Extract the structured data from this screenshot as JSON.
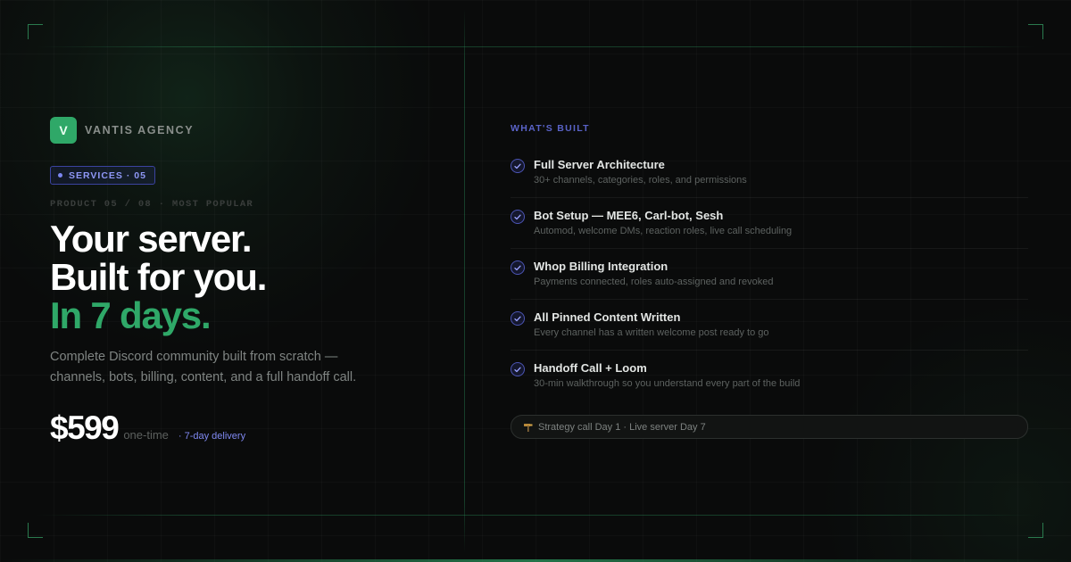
{
  "brand": {
    "logo_letter": "V",
    "name": "VANTIS AGENCY",
    "accent": "#2fa868"
  },
  "badge": {
    "label": "SERVICES · 05"
  },
  "eyebrow": "PRODUCT 05 / 08 · MOST POPULAR",
  "headline": {
    "line1": "Your server.",
    "line2": "Built for you.",
    "line3": "In 7 days."
  },
  "description": "Complete Discord community built from scratch — channels, bots, billing, content, and a full handoff call.",
  "pricing": {
    "price": "$599",
    "note": "one-time",
    "delivery": "· 7-day delivery"
  },
  "whats_built": {
    "label": "WHAT'S BUILT",
    "items": [
      {
        "title": "Full Server Architecture",
        "desc": "30+ channels, categories, roles, and permissions"
      },
      {
        "title": "Bot Setup — MEE6, Carl-bot, Sesh",
        "desc": "Automod, welcome DMs, reaction roles, live call scheduling"
      },
      {
        "title": "Whop Billing Integration",
        "desc": "Payments connected, roles auto-assigned and revoked"
      },
      {
        "title": "All Pinned Content Written",
        "desc": "Every channel has a written welcome post ready to go"
      },
      {
        "title": "Handoff Call + Loom",
        "desc": "30-min walkthrough so you understand every part of the build"
      }
    ]
  },
  "timeline": {
    "icon": "construction-icon",
    "text": "Strategy call Day 1 · Live server Day 7"
  },
  "colors": {
    "background": "#0a0b0b",
    "green": "#2fa868",
    "indigo": "#7f88f0"
  }
}
